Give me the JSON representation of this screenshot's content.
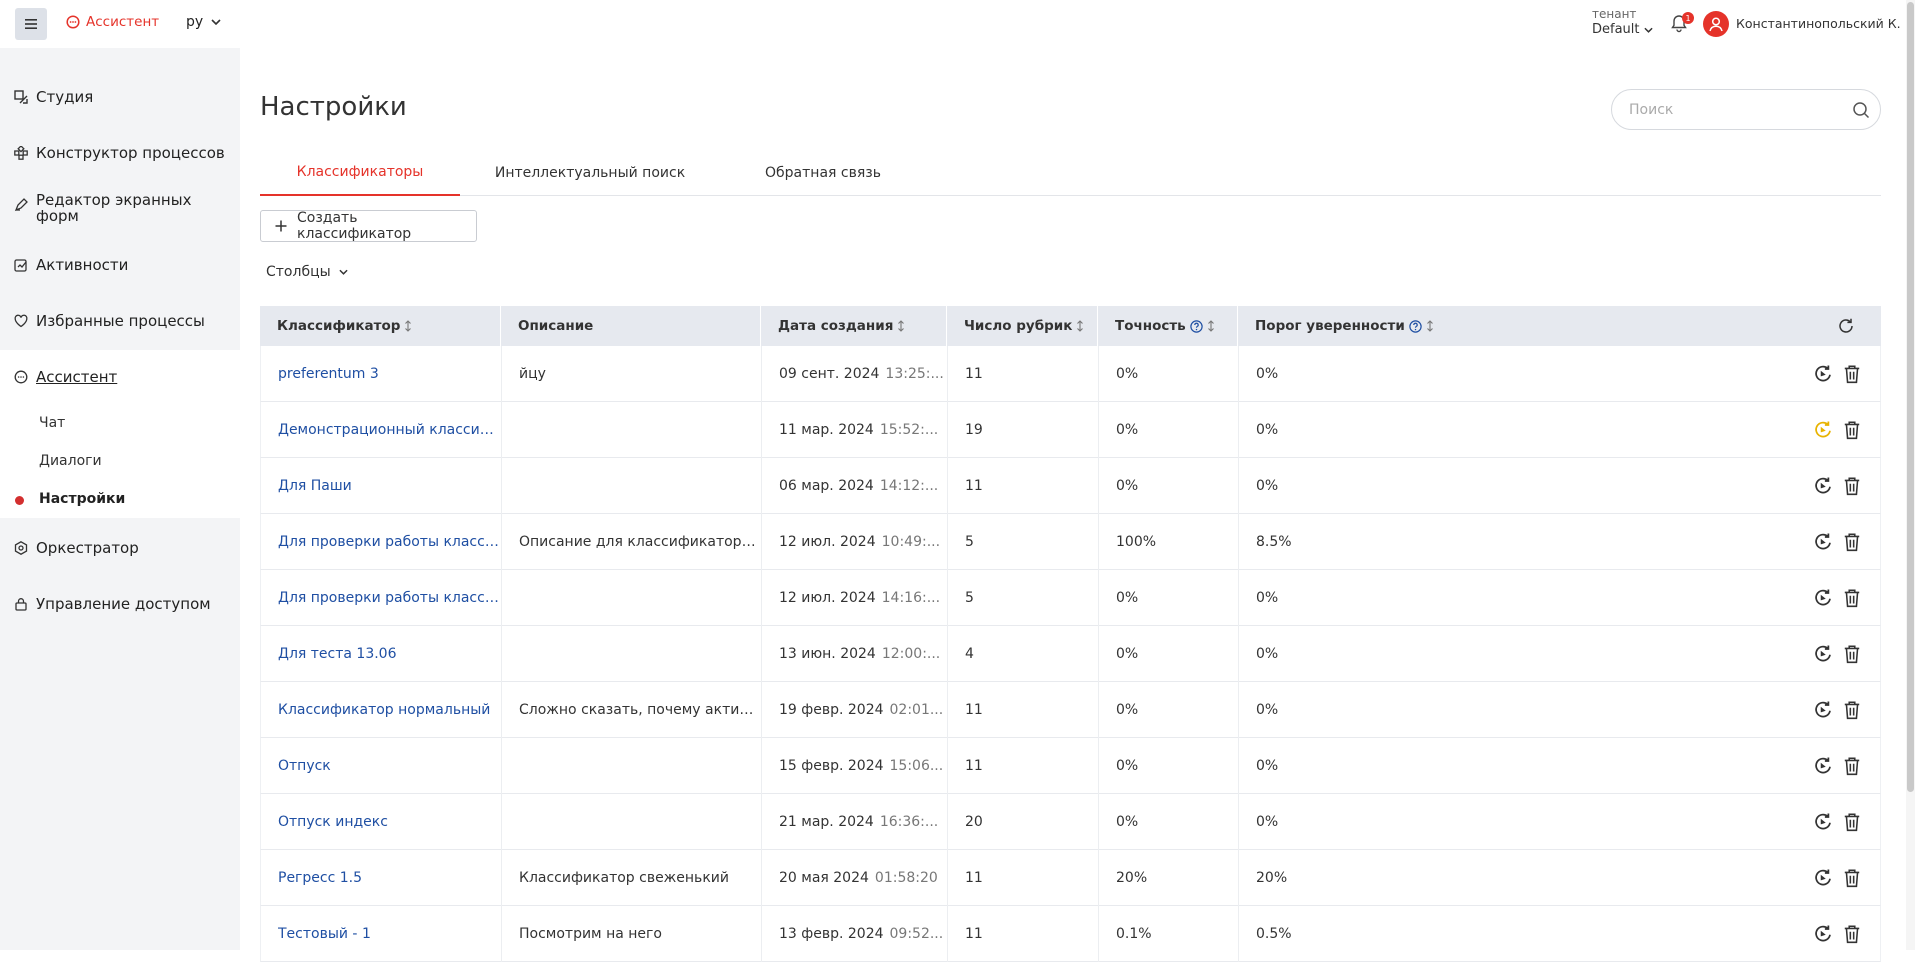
{
  "header": {
    "brand": "Ассистент",
    "language": "ру",
    "tenant_label": "тенант",
    "tenant_value": "Default",
    "notifications_count": "1",
    "user_name": "Константинопольский К."
  },
  "sidebar": {
    "items": [
      {
        "label": "Студия",
        "icon": "studio-icon"
      },
      {
        "label": "Конструктор процессов",
        "icon": "process-builder-icon"
      },
      {
        "label": "Редактор экранных форм",
        "icon": "form-editor-icon"
      },
      {
        "label": "Активности",
        "icon": "activities-icon"
      },
      {
        "label": "Избранные процессы",
        "icon": "heart-icon"
      },
      {
        "label": "Ассистент",
        "icon": "assistant-icon"
      },
      {
        "label": "Оркестратор",
        "icon": "orchestrator-icon"
      },
      {
        "label": "Управление доступом",
        "icon": "lock-icon"
      }
    ],
    "assistant_sub": [
      "Чат",
      "Диалоги",
      "Настройки"
    ]
  },
  "page": {
    "title": "Настройки",
    "search_placeholder": "Поиск",
    "tabs": [
      "Классификаторы",
      "Интеллектуальный поиск",
      "Обратная связь"
    ],
    "create_button": "Создать классификатор",
    "columns_button": "Столбцы"
  },
  "table": {
    "headers": [
      "Классификатор",
      "Описание",
      "Дата создания",
      "Число рубрик",
      "Точность",
      "Порог уверенности"
    ],
    "rows": [
      {
        "name": "preferentum 3",
        "desc": "йцу",
        "date": "09 сент. 2024",
        "time": "13:25:...",
        "rubrics": "11",
        "accuracy": "0%",
        "threshold": "0%",
        "highlight": false
      },
      {
        "name": "Демонстрационный классиф...",
        "desc": "",
        "date": "11 мар. 2024",
        "time": "15:52:...",
        "rubrics": "19",
        "accuracy": "0%",
        "threshold": "0%",
        "highlight": true
      },
      {
        "name": "Для Паши",
        "desc": "",
        "date": "06 мар. 2024",
        "time": "14:12:...",
        "rubrics": "11",
        "accuracy": "0%",
        "threshold": "0%",
        "highlight": false
      },
      {
        "name": "Для проверки работы класси...",
        "desc": "Описание для классификатора ...",
        "date": "12 июл. 2024",
        "time": "10:49:...",
        "rubrics": "5",
        "accuracy": "100%",
        "threshold": "8.5%",
        "highlight": false
      },
      {
        "name": "Для проверки работы класси...",
        "desc": "",
        "date": "12 июл. 2024",
        "time": "14:16:...",
        "rubrics": "5",
        "accuracy": "0%",
        "threshold": "0%",
        "highlight": false
      },
      {
        "name": "Для теста 13.06",
        "desc": "",
        "date": "13 июн. 2024",
        "time": "12:00:...",
        "rubrics": "4",
        "accuracy": "0%",
        "threshold": "0%",
        "highlight": false
      },
      {
        "name": "Классификатор нормальный",
        "desc": "Сложно сказать, почему активн...",
        "date": "19 февр. 2024",
        "time": "02:01...",
        "rubrics": "11",
        "accuracy": "0%",
        "threshold": "0%",
        "highlight": false
      },
      {
        "name": "Отпуск",
        "desc": "",
        "date": "15 февр. 2024",
        "time": "15:06...",
        "rubrics": "11",
        "accuracy": "0%",
        "threshold": "0%",
        "highlight": false
      },
      {
        "name": "Отпуск индекс",
        "desc": "",
        "date": "21 мар. 2024",
        "time": "16:36:...",
        "rubrics": "20",
        "accuracy": "0%",
        "threshold": "0%",
        "highlight": false
      },
      {
        "name": "Регресс 1.5",
        "desc": "Классификатор свеженький",
        "date": "20 мая 2024",
        "time": "01:58:20",
        "rubrics": "11",
        "accuracy": "20%",
        "threshold": "20%",
        "highlight": false
      },
      {
        "name": "Тестовый - 1",
        "desc": "Посмотрим на него",
        "date": "13 февр. 2024",
        "time": "09:52...",
        "rubrics": "11",
        "accuracy": "0.1%",
        "threshold": "0.5%",
        "highlight": false
      }
    ]
  },
  "colors": {
    "accent": "#e5332a",
    "link": "#1f4fa3",
    "highlight_icon": "#e8b300"
  }
}
